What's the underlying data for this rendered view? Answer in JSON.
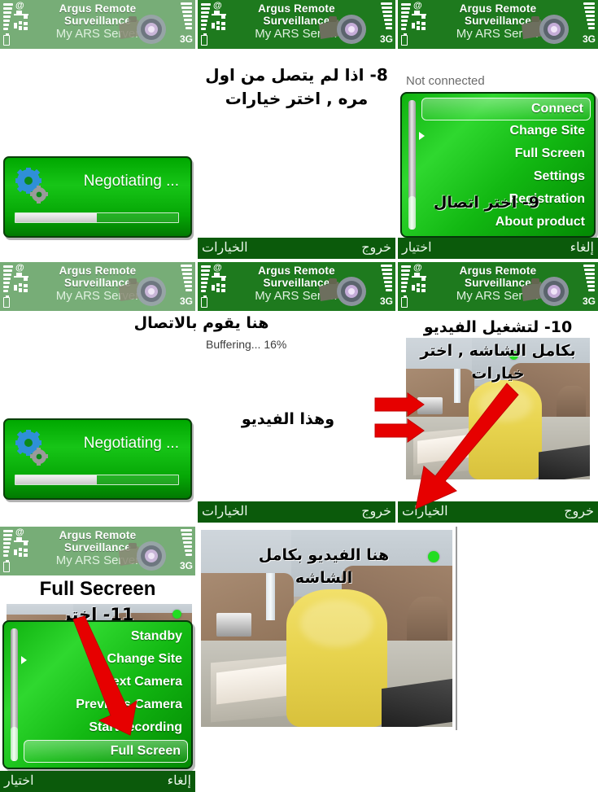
{
  "app": {
    "title_line1": "Argus Remote",
    "title_line2": "Surveillance",
    "server": "My ARS Server",
    "network_label": "3G",
    "icons": {
      "camera": "camera-logo-icon",
      "signal": "signal-bars-icon",
      "battery": "battery-icon",
      "email": "email-at-icon"
    },
    "colors": {
      "header_green": "#1e7a1e",
      "header_green_faded": "#77ad77",
      "softkey_green": "#0b5a0b",
      "menu_green": "#12b812",
      "dialog_green": "#00a800",
      "arrow_red": "#e60000",
      "status_dot_green": "#22dd22"
    }
  },
  "softkeys": {
    "options": "الخيارات",
    "exit": "خروج",
    "select": "اختيار",
    "cancel": "إلغاء"
  },
  "panels": {
    "p1": {
      "dialog_label": "Negotiating ...",
      "progress_percent": 50
    },
    "p2": {
      "note": "8- اذا لم يتصل من اول\nمره , اختر خيارات",
      "softkey_left": "الخيارات",
      "softkey_right": "خروج"
    },
    "p3": {
      "status": "Not connected",
      "menu": [
        {
          "label": "Connect",
          "selected": true
        },
        {
          "label": "Change Site",
          "selected": false
        },
        {
          "label": "Full Screen",
          "selected": false
        },
        {
          "label": "Settings",
          "selected": false
        },
        {
          "label": "Registration",
          "selected": false
        },
        {
          "label": "About product",
          "selected": false
        }
      ],
      "note": "9- اختر اتصال",
      "softkey_left": "اختيار",
      "softkey_right": "إلغاء"
    },
    "p4": {
      "note": "هنا يقوم بالاتصال",
      "dialog_label": "Negotiating ...",
      "progress_percent": 50
    },
    "p5": {
      "buffering": "Buffering... 16%",
      "note": "وهذا الفيديو",
      "softkey_left": "الخيارات",
      "softkey_right": "خروج"
    },
    "p6": {
      "note": "10- لتشغيل الفيديو\nبكامل الشاشه , اختر\nخيارات",
      "softkey_left": "الخيارات",
      "softkey_right": "خروج"
    },
    "p7": {
      "heading": "Full Secreen",
      "note": "11- اختر",
      "menu": [
        {
          "label": "Standby",
          "selected": false
        },
        {
          "label": "Change Site",
          "selected": false
        },
        {
          "label": "Next Camera",
          "selected": false
        },
        {
          "label": "Previous Camera",
          "selected": false
        },
        {
          "label": "Start recording",
          "selected": false
        },
        {
          "label": "Full Screen",
          "selected": true
        }
      ],
      "softkey_left": "اختيار",
      "softkey_right": "إلغاء"
    },
    "p8": {
      "note": "هنا الفيديو بكامل\nالشاشه"
    }
  }
}
